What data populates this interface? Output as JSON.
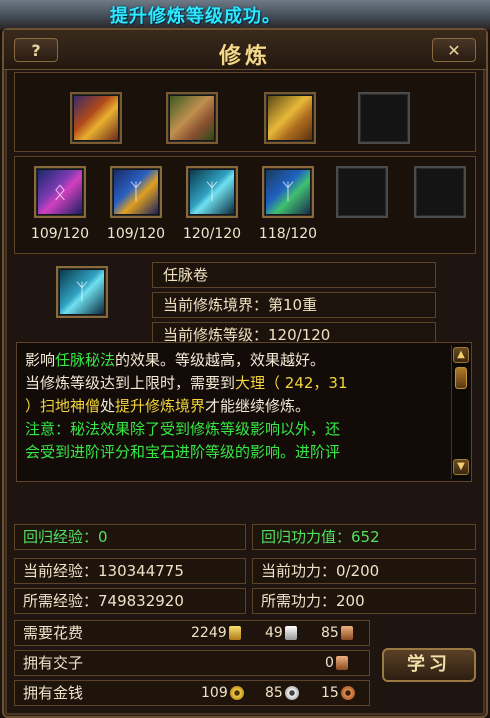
{
  "toast": "提升修炼等级成功。",
  "window": {
    "title": "修炼",
    "help": "?",
    "close": "✕"
  },
  "top_items": [
    {
      "name": "book",
      "glyph": ""
    },
    {
      "name": "scroll",
      "glyph": ""
    },
    {
      "name": "chest",
      "glyph": ""
    }
  ],
  "cards": [
    {
      "count": "109/120",
      "glyph": "ᛟ"
    },
    {
      "count": "109/120",
      "glyph": "ᛉ"
    },
    {
      "count": "120/120",
      "glyph": "ᛉ"
    },
    {
      "count": "118/120",
      "glyph": "ᛉ"
    }
  ],
  "selected": {
    "name": "任脉卷",
    "realm": "当前修炼境界：第10重",
    "level": "当前修炼等级：120/120"
  },
  "description": {
    "l1_a": "影响",
    "l1_b": "任脉秘法",
    "l1_c": "的效果。等级越高，效果越好。",
    "l2_a": "当修炼等级达到上限时，需要到",
    "l2_b": "大理（ 242，31",
    "l3_a": "）扫地神僧",
    "l3_b": "处",
    "l3_c": "提升修炼境界",
    "l3_d": "才能继续修炼。",
    "l4": "注意：秘法效果除了受到修炼等级影响以外，还",
    "l5": "会受到进阶评分和宝石进阶等级的影响。进阶评"
  },
  "stats": {
    "return_exp": "回归经验：0",
    "return_power": "回归功力值：652",
    "current_exp": "当前经验：130344775",
    "current_power": "当前功力：0/200",
    "required_exp": "所需经验：749832920",
    "required_power": "所需功力：200"
  },
  "cost": {
    "label": "需要花费",
    "gold": "2249",
    "silver": "49",
    "copper": "85"
  },
  "jiaozi": {
    "label": "拥有交子",
    "value": "0"
  },
  "money": {
    "label": "拥有金钱",
    "gold": "109",
    "silver": "85",
    "copper": "15"
  },
  "learn_button": "学习"
}
